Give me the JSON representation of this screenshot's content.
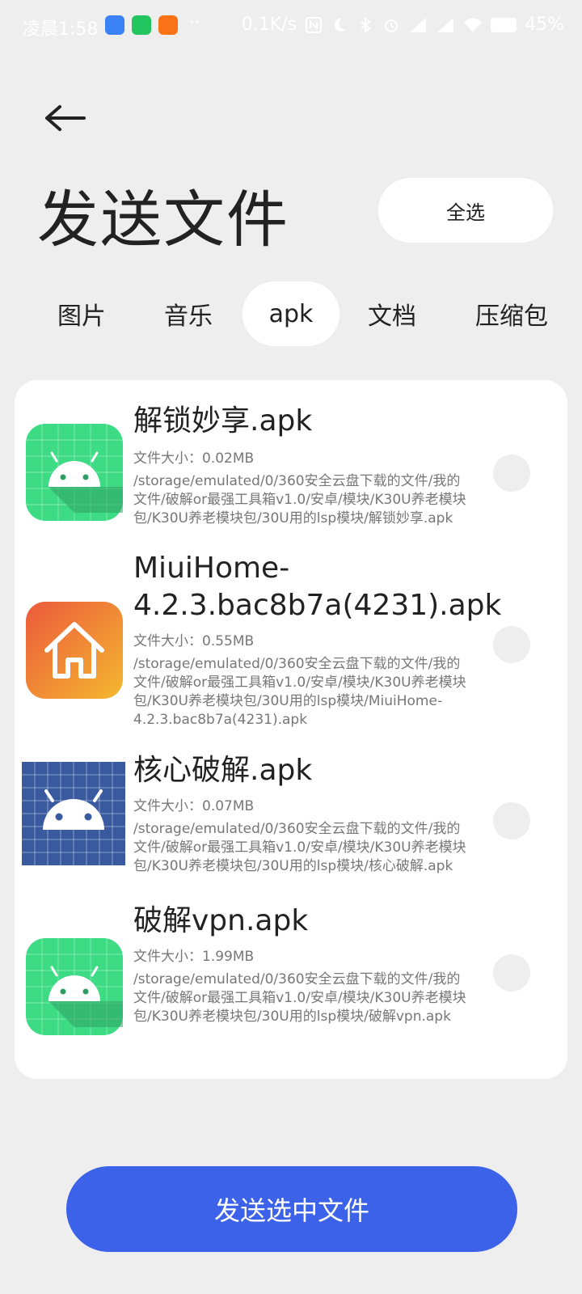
{
  "status_bar": {
    "time": "凌晨1:58",
    "dots": "··",
    "net_speed": "0.1K/s",
    "battery": "45%"
  },
  "header": {
    "title": "发送文件",
    "select_all": "全选"
  },
  "tabs": [
    {
      "label": "图片",
      "active": false
    },
    {
      "label": "音乐",
      "active": false
    },
    {
      "label": "apk",
      "active": true
    },
    {
      "label": "文档",
      "active": false
    },
    {
      "label": "压缩包",
      "active": false
    }
  ],
  "files": [
    {
      "name": "解锁妙享.apk",
      "size": "文件大小：0.02MB",
      "path": "/storage/emulated/0/360安全云盘下载的文件/我的文件/破解or最强工具箱v1.0/安卓/模块/K30U养老模块包/K30U养老模块包/30U用的lsp模块/解锁妙享.apk",
      "icon": "android-green-icon"
    },
    {
      "name": "MiuiHome-4.2.3.bac8b7a(4231).apk",
      "size": "文件大小：0.55MB",
      "path": "/storage/emulated/0/360安全云盘下载的文件/我的文件/破解or最强工具箱v1.0/安卓/模块/K30U养老模块包/K30U养老模块包/30U用的lsp模块/MiuiHome-4.2.3.bac8b7a(4231).apk",
      "icon": "home-orange-icon"
    },
    {
      "name": "核心破解.apk",
      "size": "文件大小：0.07MB",
      "path": "/storage/emulated/0/360安全云盘下载的文件/我的文件/破解or最强工具箱v1.0/安卓/模块/K30U养老模块包/K30U养老模块包/30U用的lsp模块/核心破解.apk",
      "icon": "android-blue-icon"
    },
    {
      "name": "破解vpn.apk",
      "size": "文件大小：1.99MB",
      "path": "/storage/emulated/0/360安全云盘下载的文件/我的文件/破解or最强工具箱v1.0/安卓/模块/K30U养老模块包/K30U养老模块包/30U用的lsp模块/破解vpn.apk",
      "icon": "android-green-icon"
    }
  ],
  "send_button": "发送选中文件",
  "colors": {
    "accent": "#3b62e8",
    "background": "#eeeeee",
    "card": "#ffffff",
    "android_green": "#3ddc84",
    "android_blue": "#3a5aa0"
  }
}
